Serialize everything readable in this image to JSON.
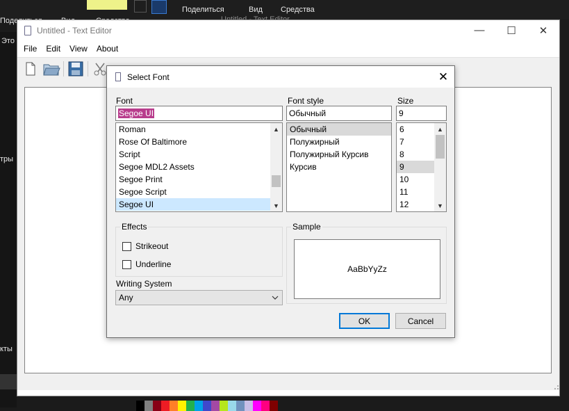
{
  "background": {
    "top_texts": [
      "Поделиться",
      "Вид",
      "Средства",
      "Поделиться",
      "Вид",
      "Средства",
      "Untitled - Text Editor"
    ],
    "left_texts": [
      "Это",
      "тры",
      "кты"
    ],
    "palette_colors": [
      "#000000",
      "#7f7f7f",
      "#880015",
      "#ed1c24",
      "#ff7f27",
      "#fff200",
      "#22b14c",
      "#00a2e8",
      "#3f48cc",
      "#a349a4",
      "#b5e61d",
      "#99d9ea",
      "#7092be",
      "#c8bfe7",
      "#ff00ff",
      "#ff0080",
      "#7f0000"
    ]
  },
  "window": {
    "title": "Untitled - Text Editor",
    "controls": {
      "minimize": "—",
      "maximize": "☐",
      "close": "✕"
    },
    "menu": [
      "File",
      "Edit",
      "View",
      "About"
    ]
  },
  "dialog": {
    "title": "Select Font",
    "close_glyph": "✕",
    "font": {
      "label": "Font",
      "value": "Segoe UI",
      "items": [
        "Roman",
        "Rose Of Baltimore",
        "Script",
        "Segoe MDL2 Assets",
        "Segoe Print",
        "Segoe Script",
        "Segoe UI"
      ],
      "selected_index": 6
    },
    "style": {
      "label": "Font style",
      "value": "Обычный",
      "items": [
        "Обычный",
        "Полужирный",
        "Полужирный Курсив",
        "Курсив"
      ],
      "selected_index": 0
    },
    "size": {
      "label": "Size",
      "value": "9",
      "items": [
        "6",
        "7",
        "8",
        "9",
        "10",
        "11",
        "12"
      ],
      "selected_index": 3
    },
    "effects": {
      "label": "Effects",
      "strikeout_label": "Strikeout",
      "strikeout_checked": false,
      "underline_label": "Underline",
      "underline_checked": false
    },
    "sample": {
      "label": "Sample",
      "text": "AaBbYyZz"
    },
    "writing_system": {
      "label": "Writing System",
      "value": "Any"
    },
    "buttons": {
      "ok": "OK",
      "cancel": "Cancel"
    }
  },
  "colors": {
    "selection_highlight": "#b83c8c",
    "list_selection": "#cce8ff",
    "default_button_border": "#0078d7"
  }
}
